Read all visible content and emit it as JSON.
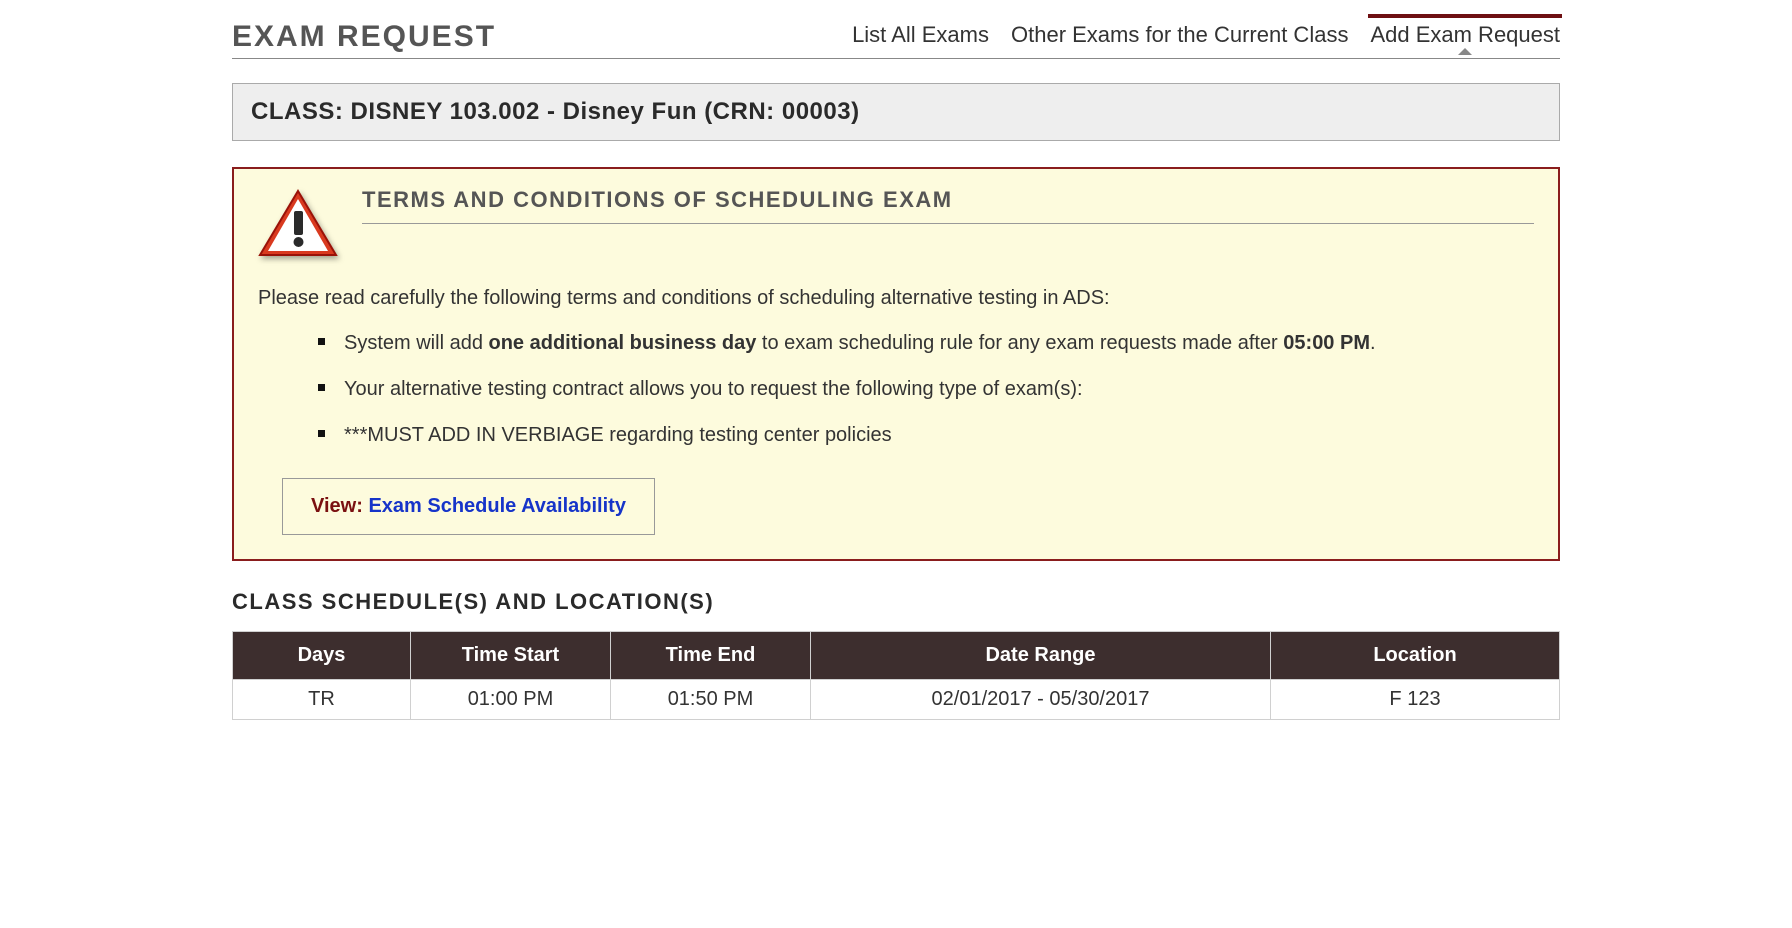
{
  "header": {
    "title": "EXAM REQUEST",
    "tabs": {
      "list_all": "List All Exams",
      "other_current": "Other Exams for the Current Class",
      "add_request": "Add Exam Request"
    }
  },
  "class_banner": "CLASS: DISNEY 103.002 - Disney Fun (CRN: 00003)",
  "terms": {
    "title": "TERMS AND CONDITIONS OF SCHEDULING EXAM",
    "intro": "Please read carefully the following terms and conditions of scheduling alternative testing in ADS:",
    "item1_pre": "System will add ",
    "item1_bold1": "one additional business day",
    "item1_mid": " to exam scheduling rule for any exam requests made after ",
    "item1_bold2": "05:00 PM",
    "item1_post": ".",
    "item2": "Your alternative testing contract allows you to request the following type of exam(s):",
    "item3": "***MUST ADD IN VERBIAGE regarding testing center policies",
    "view_label": "View: ",
    "view_link": "Exam Schedule Availability"
  },
  "schedule": {
    "section_title": "CLASS SCHEDULE(S) AND LOCATION(S)",
    "headers": {
      "days": "Days",
      "time_start": "Time Start",
      "time_end": "Time End",
      "date_range": "Date Range",
      "location": "Location"
    },
    "rows": [
      {
        "days": "TR",
        "time_start": "01:00 PM",
        "time_end": "01:50 PM",
        "date_range": "02/01/2017 - 05/30/2017",
        "location": "F 123"
      }
    ]
  }
}
